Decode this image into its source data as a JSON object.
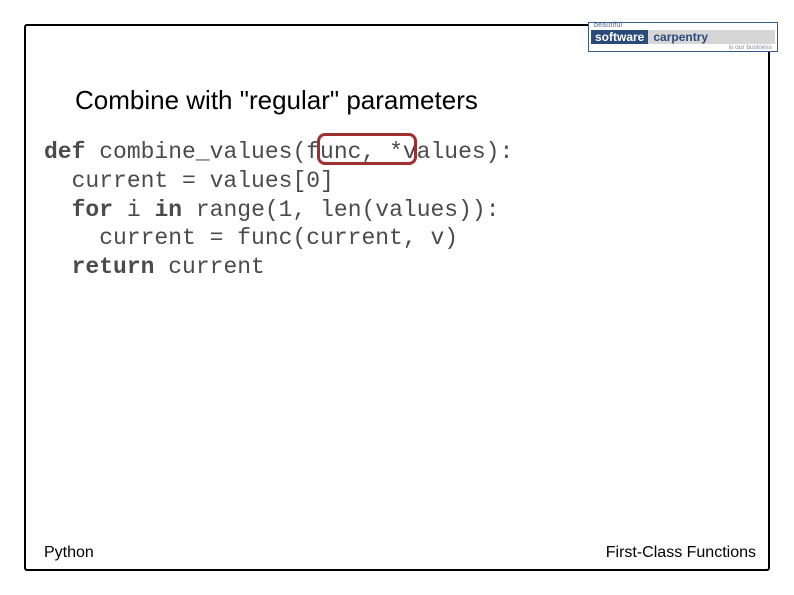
{
  "logo": {
    "top": "beautiful",
    "software": "software",
    "carpentry": "carpentry",
    "bottom": "is our business"
  },
  "title": "Combine with \"regular\" parameters",
  "code": {
    "l1a": "def",
    "l1b": " combine_values(func, *values):",
    "l2": "  current = values[0]",
    "l3a": "  ",
    "l3b": "for",
    "l3c": " i ",
    "l3d": "in",
    "l3e": " range(1, len(values)):",
    "l4": "    current = func(current, v)",
    "l5a": "  ",
    "l5b": "return",
    "l5c": " current"
  },
  "footer": {
    "left": "Python",
    "right": "First-Class Functions"
  }
}
